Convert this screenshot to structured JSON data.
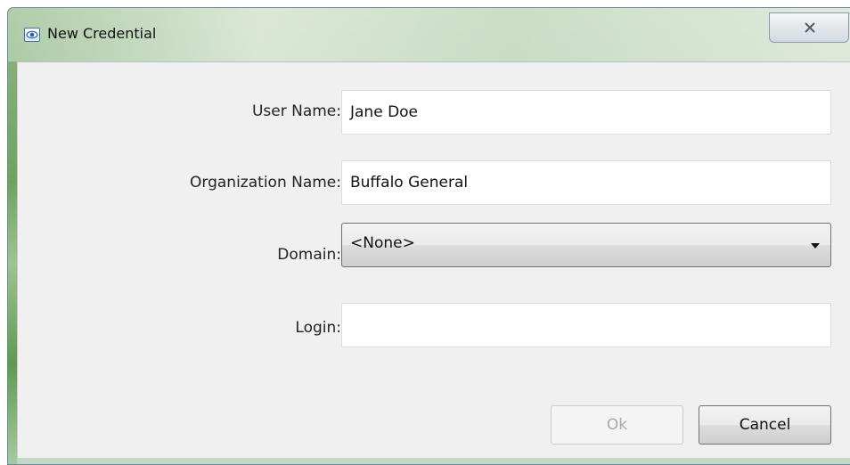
{
  "window": {
    "title": "New Credential",
    "app_icon": "eye-icon",
    "close_icon": "close-x-icon"
  },
  "form": {
    "user_name": {
      "label": "User Name:",
      "value": "Jane Doe"
    },
    "organization_name": {
      "label": "Organization Name:",
      "value": "Buffalo General"
    },
    "domain": {
      "label": "Domain:",
      "selected": "<None>",
      "icon": "dropdown-arrow-icon"
    },
    "login": {
      "label": "Login:",
      "value": ""
    }
  },
  "buttons": {
    "ok_label": "Ok",
    "ok_enabled": false,
    "cancel_label": "Cancel"
  }
}
